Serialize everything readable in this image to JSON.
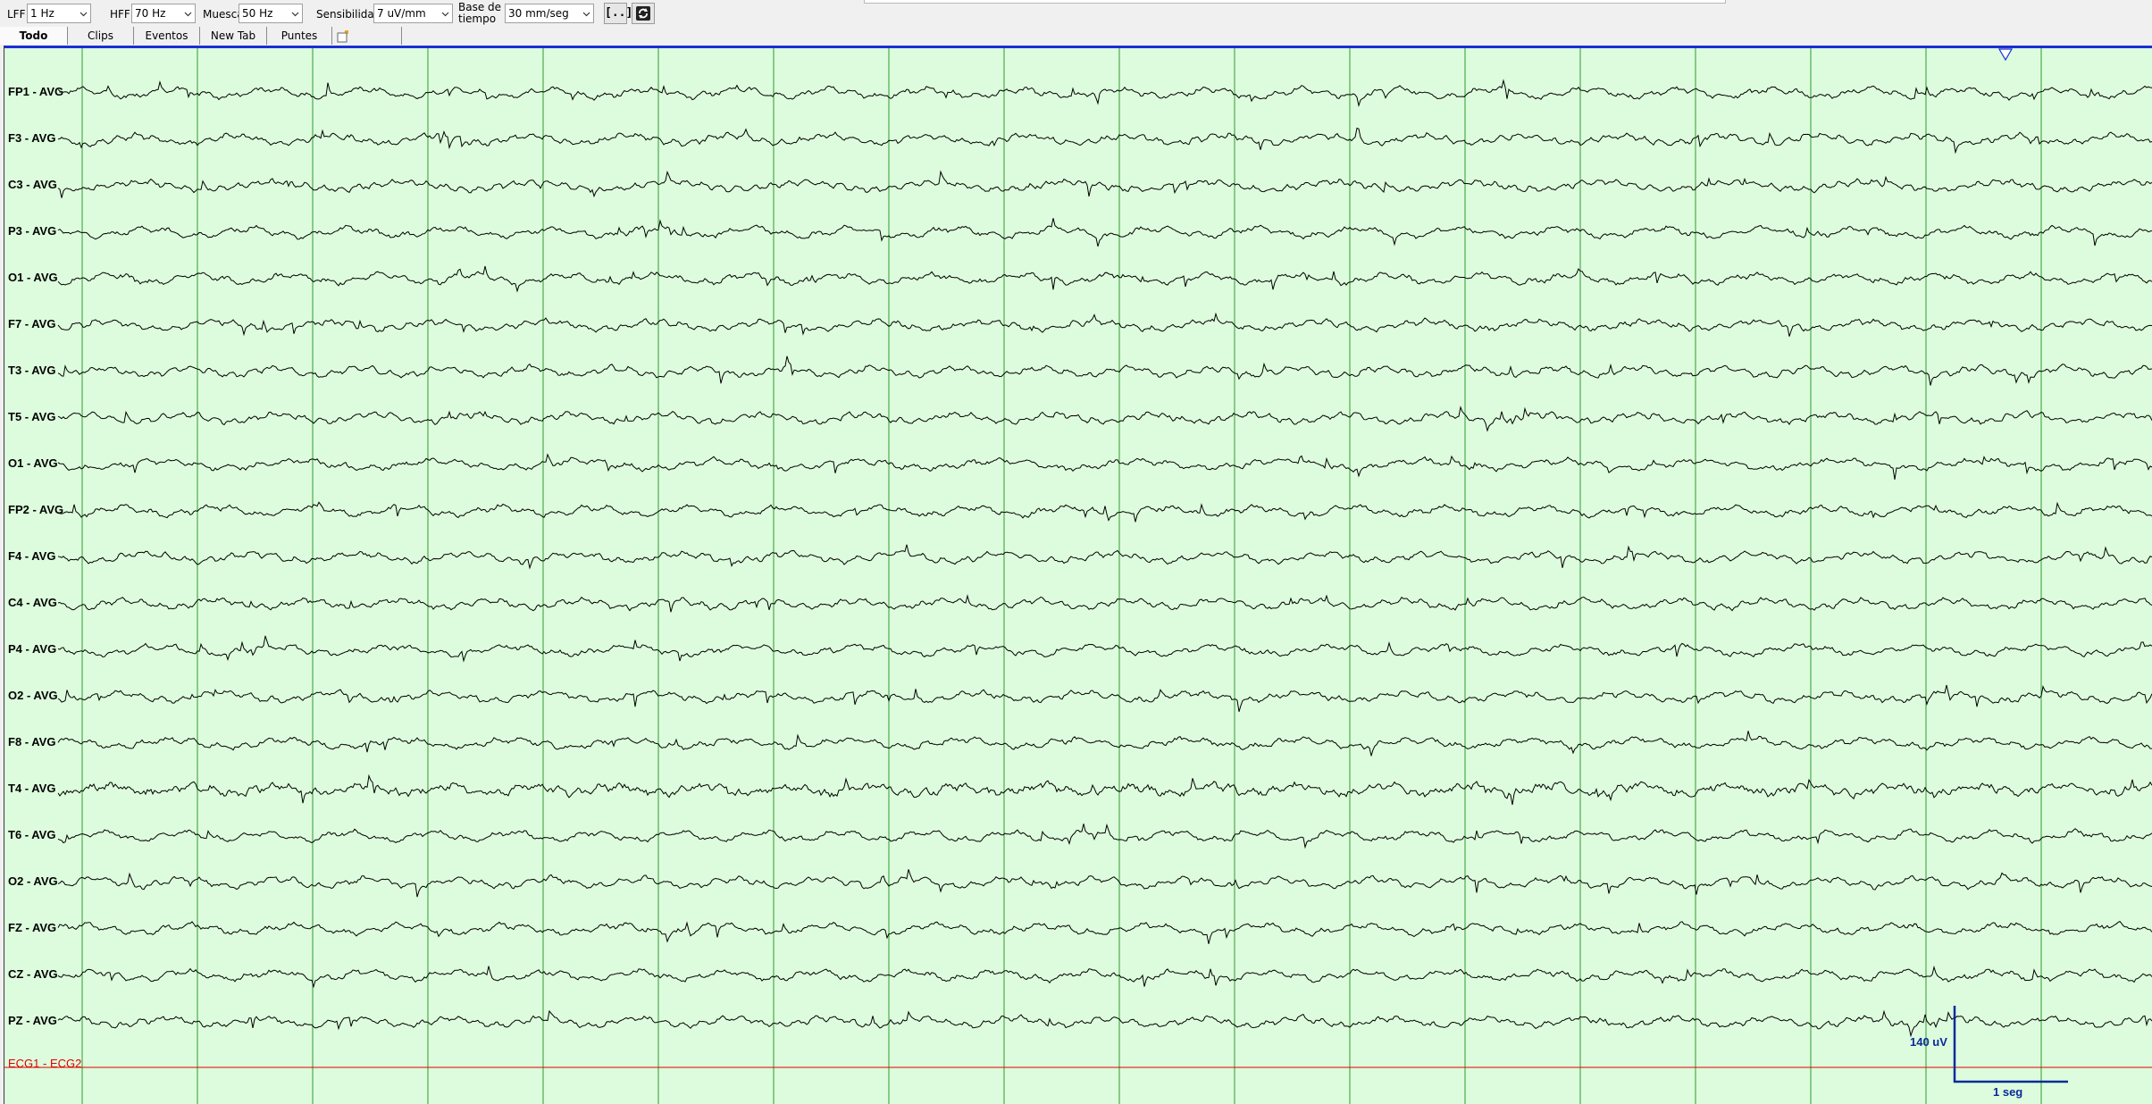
{
  "toolbar": {
    "lff_label": "LFF",
    "lff_value": "1 Hz",
    "hff_label": "HFF",
    "hff_value": "70 Hz",
    "notch_label": "Muesca",
    "notch_value": "50 Hz",
    "sensitivity_label": "Sensibilidad",
    "sensitivity_value": "7 uV/mm",
    "timebase_label_line1": "Base de",
    "timebase_label_line2": "tiempo",
    "timebase_value": "30 mm/seg",
    "bracket_button_label": "[..]",
    "refresh_icon": "refresh-icon"
  },
  "tabs": [
    {
      "label": "Todo",
      "active": true
    },
    {
      "label": "Clips"
    },
    {
      "label": "Eventos"
    },
    {
      "label": "New Tab"
    },
    {
      "label": "Puntes"
    }
  ],
  "new_tab_icon": "new-tab-icon",
  "channels": [
    "FP1 - AVG",
    "F3 - AVG",
    "C3 - AVG",
    "P3 - AVG",
    "O1 - AVG",
    "F7 - AVG",
    "T3 - AVG",
    "T5 - AVG",
    "O1 - AVG",
    "FP2 - AVG",
    "F4 - AVG",
    "C4 - AVG",
    "P4 - AVG",
    "O2 - AVG",
    "F8 - AVG",
    "T4 - AVG",
    "T6 - AVG",
    "O2 - AVG",
    "FZ - AVG",
    "CZ - AVG",
    "PZ - AVG"
  ],
  "ecg_channel": "ECG1 - ECG2",
  "calibration": {
    "amplitude": "140 uV",
    "time": "1 seg"
  },
  "colors": {
    "background": "#ddfcdd",
    "second_gridline": "#2e9a2e",
    "trace": "#000000",
    "top_marker": "#1b2fd4",
    "ecg": "#e00000",
    "calibration": "#0a2a9a"
  },
  "cursor_icon": "cursor-triangle-icon"
}
